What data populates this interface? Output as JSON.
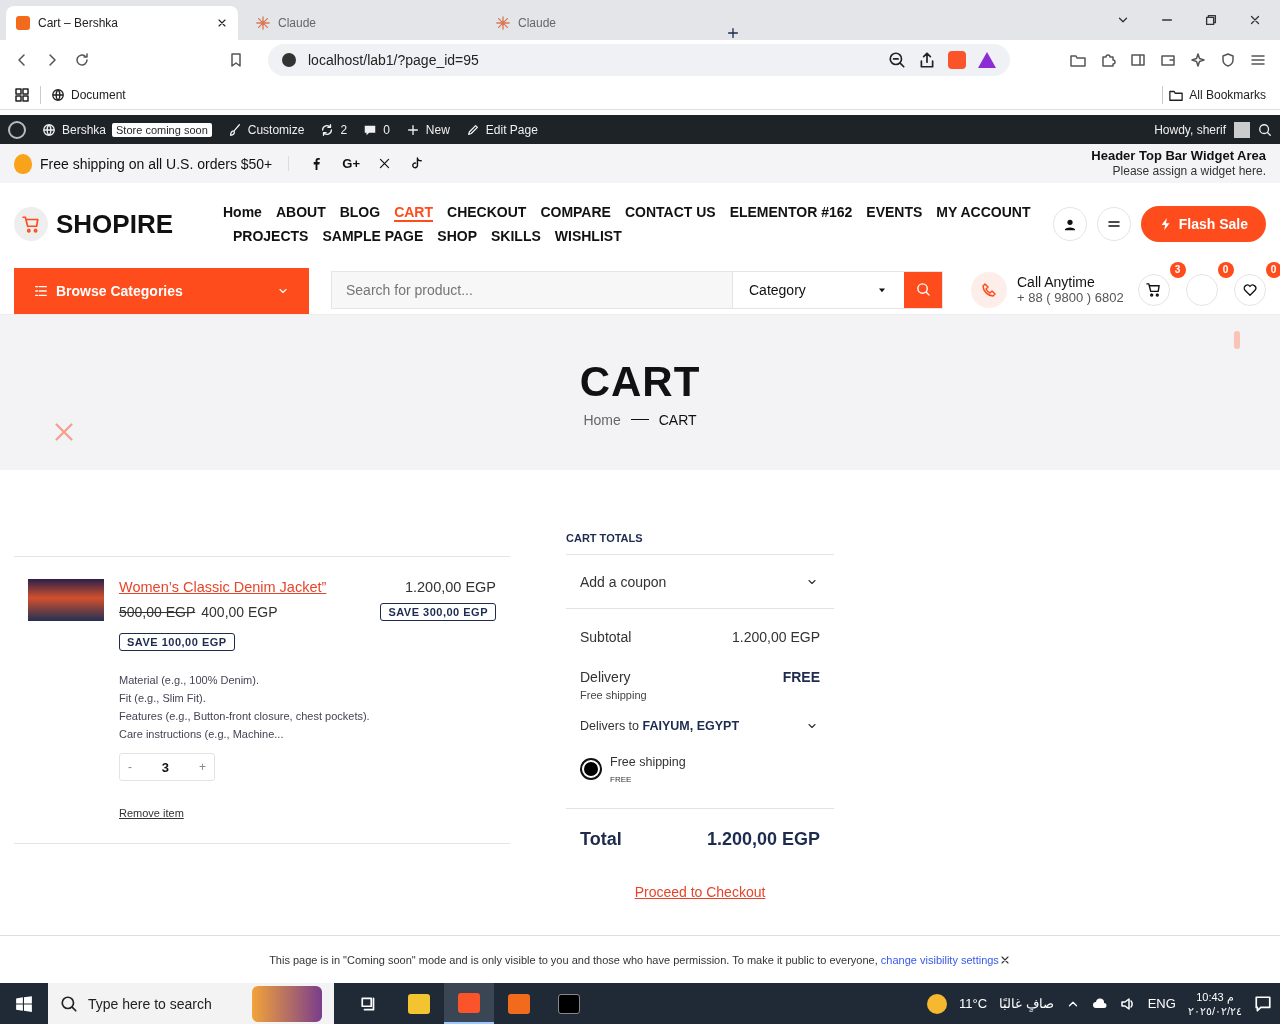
{
  "browser": {
    "tabs": [
      {
        "title": "Cart – Bershka",
        "selected": true,
        "kind": "site"
      },
      {
        "title": "Claude",
        "selected": false,
        "kind": "claude"
      },
      {
        "title": "Claude",
        "selected": false,
        "kind": "claude"
      }
    ],
    "address": "localhost/lab1/?page_id=95",
    "bookmarks": [
      "Document"
    ],
    "all_bookmarks": "All Bookmarks"
  },
  "admin_bar": {
    "site": "Bershka",
    "badge": "Store coming soon",
    "customize": "Customize",
    "updates": "2",
    "comments": "0",
    "new": "New",
    "edit": "Edit Page",
    "greeting": "Howdy, sherif"
  },
  "top_bar": {
    "promo": "Free shipping on all U.S. orders $50+",
    "google_plus": "G+",
    "widget_title": "Header Top Bar Widget Area",
    "widget_note": "Please assign a widget here."
  },
  "header": {
    "logo": "SHOPIRE",
    "nav": [
      {
        "label": "Home",
        "selected": false
      },
      {
        "label": "ABOUT",
        "selected": false
      },
      {
        "label": "BLOG",
        "selected": false
      },
      {
        "label": "CART",
        "selected": true
      },
      {
        "label": "CHECKOUT",
        "selected": false
      },
      {
        "label": "COMPARE",
        "selected": false
      },
      {
        "label": "CONTACT US",
        "selected": false
      },
      {
        "label": "ELEMENTOR #162",
        "selected": false
      },
      {
        "label": "EVENTS",
        "selected": false
      },
      {
        "label": "MY ACCOUNT",
        "selected": false
      },
      {
        "label": "PROJECTS",
        "selected": false
      },
      {
        "label": "SAMPLE PAGE",
        "selected": false
      },
      {
        "label": "SHOP",
        "selected": false
      },
      {
        "label": "SKILLS",
        "selected": false
      },
      {
        "label": "WISHLIST",
        "selected": false
      }
    ],
    "flash": "Flash Sale"
  },
  "search_row": {
    "browse": "Browse Categories",
    "placeholder": "Search for product...",
    "category": "Category",
    "call_label": "Call Anytime",
    "phone": "+ 88 ( 9800 ) 6802",
    "cart_count": "3",
    "compare_count": "0",
    "wishlist_count": "0"
  },
  "hero": {
    "title": "CART",
    "breadcrumb": [
      "Home",
      "CART"
    ]
  },
  "cart_item": {
    "name": "Women’s Classic Denim Jacket”",
    "was_price": "500,00 EGP",
    "price": "400,00 EGP",
    "save": "SAVE 100,00 EGP",
    "line_total": "1.200,00 EGP",
    "line_save": "SAVE 300,00 EGP",
    "description": [
      "Material (e.g., 100% Denim).",
      "Fit (e.g., Slim Fit).",
      "Features (e.g., Button-front closure, chest pockets).",
      "Care instructions (e.g., Machine..."
    ],
    "minus": "-",
    "quantity": "3",
    "plus": "+",
    "remove": "Remove item"
  },
  "totals": {
    "heading": "CART TOTALS",
    "coupon": "Add a coupon",
    "subtotal_label": "Subtotal",
    "subtotal": "1.200,00 EGP",
    "delivery_label": "Delivery",
    "delivery": "FREE",
    "delivery_method": "Free shipping",
    "delivers_to": "Delivers to",
    "location": "FAIYUM, EGYPT",
    "options": [
      {
        "label": "Free shipping",
        "price": "FREE",
        "selected": true
      }
    ],
    "total_label": "Total",
    "total": "1.200,00 EGP",
    "checkout": "Proceed to Checkout"
  },
  "notice": {
    "text": "This page is in \"Coming soon\" mode and is only visible to you and those who have permission. To make it public to everyone,",
    "link": "change visibility settings"
  },
  "taskbar": {
    "search": "Type here to search",
    "temperature": "11°C",
    "weather": "صافٍ غالبًا",
    "language": "ENG",
    "time": "10:43 م",
    "date": "٢٠٢٥/٠٢/٢٤"
  }
}
